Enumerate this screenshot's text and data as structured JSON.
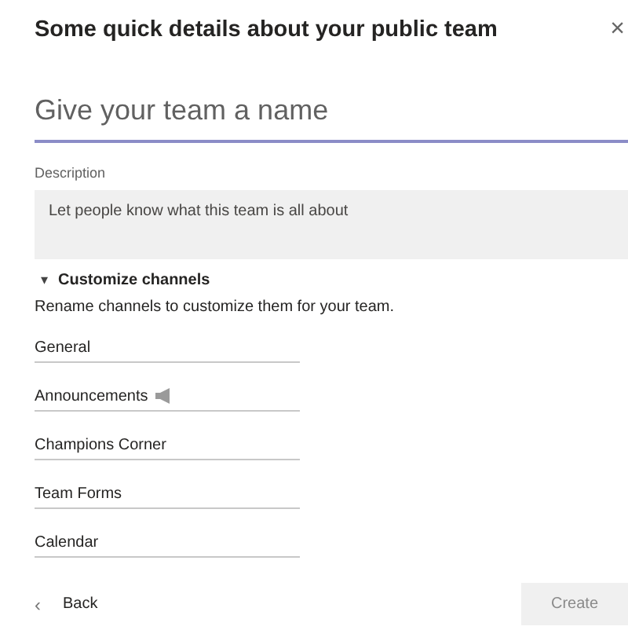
{
  "dialog": {
    "title": "Some quick details about your public team",
    "close": "×"
  },
  "name_field": {
    "placeholder": "Give your team a name"
  },
  "description": {
    "label": "Description",
    "placeholder": "Let people know what this team is all about"
  },
  "channels_section": {
    "toggle": "▾",
    "title": "Customize channels",
    "expanded": true,
    "hint": "Rename channels to customize them for your team.",
    "channels": [
      {
        "value": "General",
        "kind": "plain"
      },
      {
        "value": "Announcements",
        "kind": "announcement"
      },
      {
        "value": "Champions Corner",
        "kind": "plain"
      },
      {
        "value": "Team Forms",
        "kind": "plain"
      },
      {
        "value": "Calendar",
        "kind": "plain"
      }
    ]
  },
  "footer": {
    "back_icon": "‹",
    "back": "Back",
    "create": "Create",
    "create_disabled": true
  }
}
